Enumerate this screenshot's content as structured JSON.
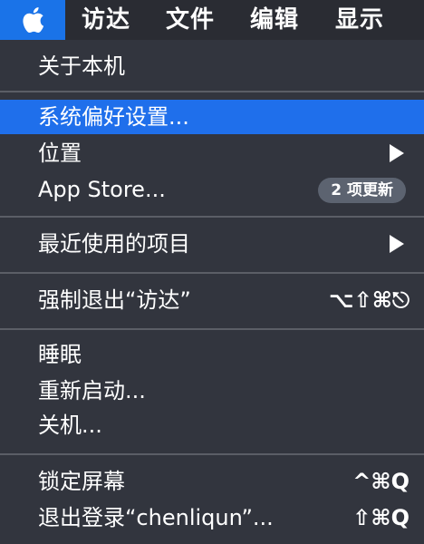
{
  "menubar": {
    "apple_icon": "apple-logo",
    "items": [
      "访达",
      "文件",
      "编辑",
      "显示"
    ]
  },
  "menu": {
    "about": "关于本机",
    "prefs": "系统偏好设置...",
    "location": "位置",
    "appstore": "App Store...",
    "appstore_badge": "2 项更新",
    "recent": "最近使用的项目",
    "force_quit": "强制退出“访达”",
    "force_quit_shortcut": "⌥⇧⌘⎋",
    "sleep": "睡眠",
    "restart": "重新启动...",
    "shutdown": "关机...",
    "lock": "锁定屏幕",
    "lock_shortcut": "^⌘Q",
    "logout": "退出登录“chenliqun”...",
    "logout_shortcut": "⇧⌘Q"
  },
  "colors": {
    "highlight": "#1f6feb",
    "menu_bg": "#32353e",
    "apple_tile": "#1a73e8"
  }
}
